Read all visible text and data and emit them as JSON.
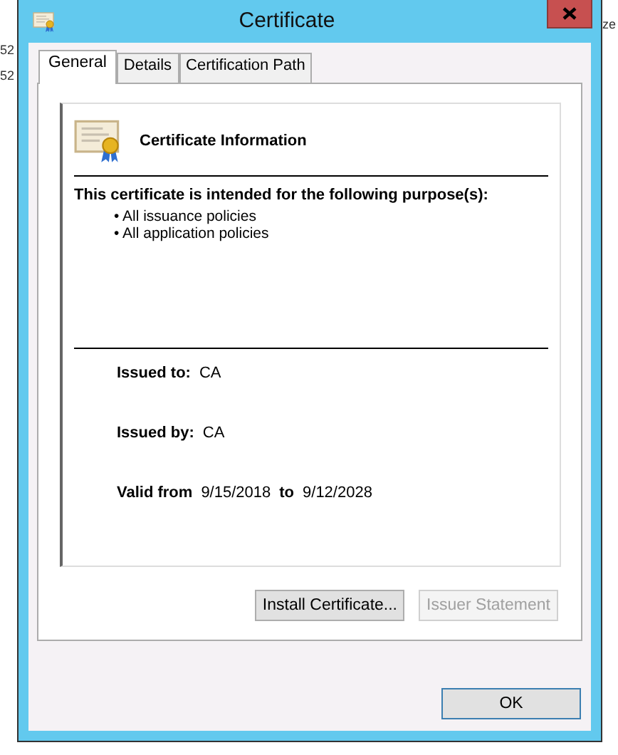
{
  "background": {
    "left_texts": [
      "52",
      "52"
    ],
    "right_text": "ze"
  },
  "window": {
    "title": "Certificate"
  },
  "tabs": [
    {
      "label": "General",
      "selected": true
    },
    {
      "label": "Details",
      "selected": false
    },
    {
      "label": "Certification Path",
      "selected": false
    }
  ],
  "info": {
    "heading": "Certificate Information",
    "purpose_heading": "This certificate is intended for the following purpose(s):",
    "purposes": [
      "• All issuance policies",
      "• All application policies"
    ],
    "issued_to": {
      "label": "Issued to:",
      "value": "CA"
    },
    "issued_by": {
      "label": "Issued by:",
      "value": "CA"
    },
    "validity": {
      "from_label": "Valid from",
      "from": "9/15/2018",
      "to_label": "to",
      "to": "9/12/2028"
    }
  },
  "buttons": [
    {
      "label": "Install Certificate...",
      "disabled": false
    },
    {
      "label": "Issuer Statement",
      "disabled": true
    }
  ],
  "ok": {
    "label": "OK"
  }
}
